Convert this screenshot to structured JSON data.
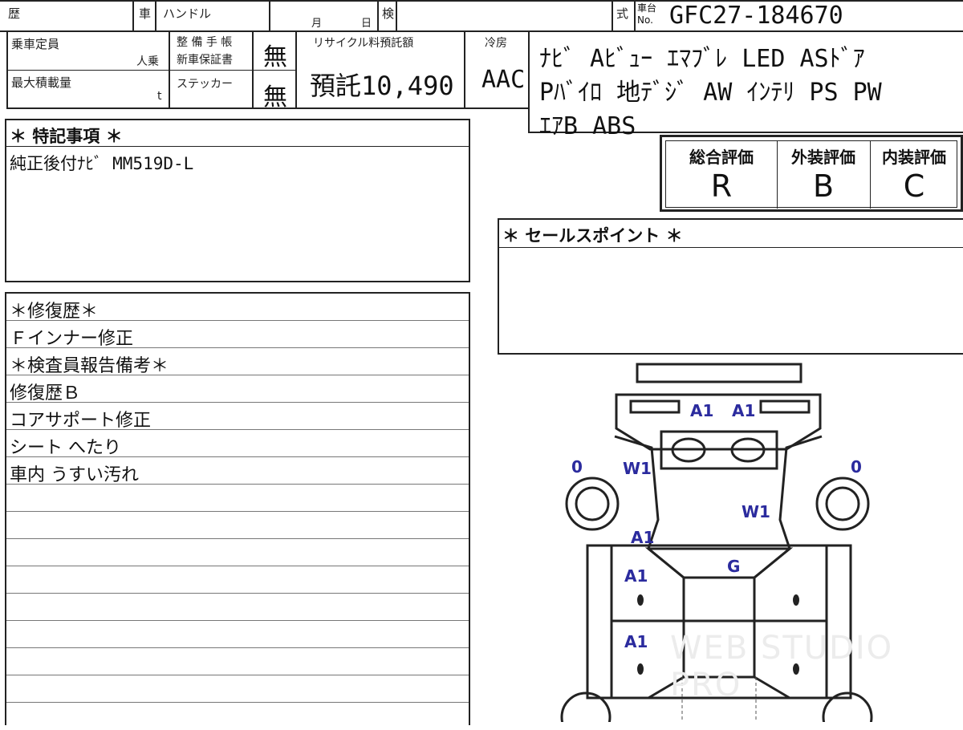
{
  "header": {
    "reki_label": "歴",
    "sha_label": "車",
    "handle_label": "ハンドル",
    "month_label": "月",
    "day_label": "日",
    "ken_label": "検",
    "shiki_label": "式",
    "chassis_label_top": "車台",
    "chassis_label_bottom": "No.",
    "chassis_no": "GFC27-184670"
  },
  "specs": {
    "capacity_label": "乗車定員",
    "capacity_unit": "人乗",
    "load_label": "最大積載量",
    "load_unit": "t",
    "maint_label": "整 備 手 帳",
    "warranty_label": "新車保証書",
    "maint_value": "無",
    "sticker_label": "ステッカー",
    "sticker_value": "無",
    "recycle_label": "リサイクル料預託額",
    "recycle_value": "預託10,490",
    "ac_label": "冷房",
    "ac_value": "AAC"
  },
  "equipment": {
    "line1": "ﾅﾋﾞ Aﾋﾞｭｰ ｴﾏﾌﾞﾚ LED ASﾄﾞｱ",
    "line2": "Pﾊﾞｲﾛ 地ﾃﾞｼﾞ AW ｲﾝﾃﾘ PS PW",
    "line3": "ｴｱB ABS"
  },
  "grades": {
    "overall_label": "総合評価",
    "overall": "R",
    "exterior_label": "外装評価",
    "exterior": "B",
    "interior_label": "内装評価",
    "interior": "C"
  },
  "notes": {
    "special_title": "＊ 特記事項 ＊",
    "special_line1": "純正後付ﾅﾋﾞ MM519D-L",
    "sales_title": "＊ セールスポイント ＊",
    "repair_title": "＊修復歴＊",
    "repair_line1": "Ｆインナー修正",
    "inspector_title": "＊検査員報告備考＊",
    "inspector_lines": [
      "修復歴Ｂ",
      "コアサポート修正",
      "シート へたり",
      "車内 うすい汚れ"
    ]
  },
  "diagram_marks": {
    "front_a1_left": "A1",
    "front_a1_right": "A1",
    "tire_front_left": "0",
    "tire_front_right": "0",
    "w1_left": "W1",
    "w1_right": "W1",
    "a1_pillar": "A1",
    "g_roof": "G",
    "a1_door_front": "A1",
    "a1_door_rear": "A1"
  },
  "watermark": "WEB STUDIO PRO",
  "colors": {
    "line": "#222222",
    "mark": "#2b2b9e"
  }
}
